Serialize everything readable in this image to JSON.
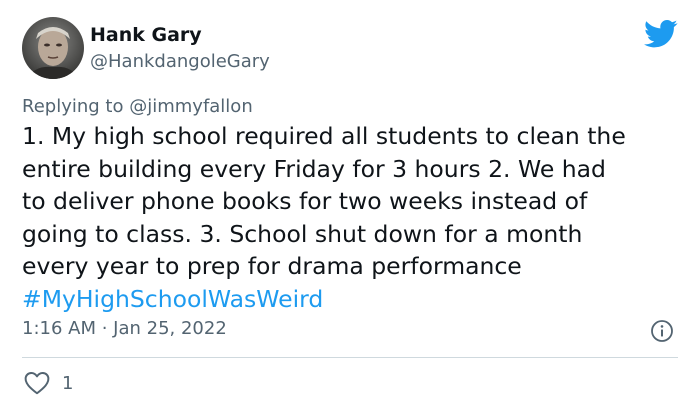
{
  "header": {
    "display_name": "Hank Gary",
    "handle": "@HankdangoleGary",
    "avatar_icon": "profile-photo",
    "platform_icon": "twitter-bird-icon",
    "accent": "#1d9bf0"
  },
  "reply_context": {
    "prefix": "Replying to",
    "mention": "@jimmyfallon"
  },
  "tweet": {
    "lines": [
      "1. My high school required all students to clean the",
      "entire building every Friday for 3 hours 2. We had",
      "to deliver phone books for two weeks instead of",
      "going to class. 3. School shut down for a month",
      "every year to prep for drama performance"
    ],
    "hashtag": "#MyHighSchoolWasWeird"
  },
  "meta": {
    "timestamp": "1:16 AM · Jan 25, 2022",
    "info_icon": "info-icon"
  },
  "actions": {
    "like_icon": "heart-icon",
    "like_count": "1"
  }
}
